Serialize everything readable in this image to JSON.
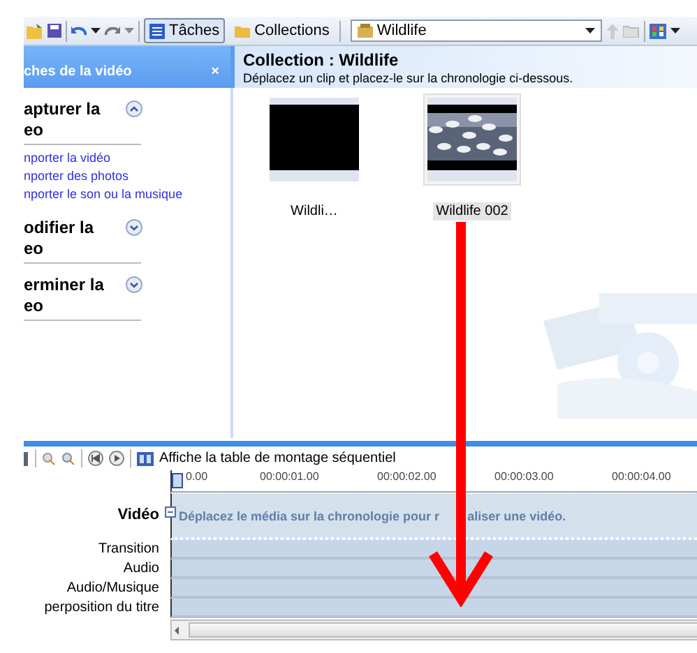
{
  "toolbar": {
    "tasks_button": {
      "label": "Tâches",
      "selected": true
    },
    "collections_button": {
      "label": "Collections",
      "selected": false
    },
    "collection_dropdown": {
      "value": "Wildlife"
    }
  },
  "tasks_pane": {
    "title": "ches de la vidéo",
    "close": "×",
    "sections": [
      {
        "title_lines": [
          "apturer la",
          "eo"
        ],
        "expanded": true,
        "links": [
          "nporter la vidéo",
          "nporter des photos",
          "nporter le son ou la musique"
        ]
      },
      {
        "title_lines": [
          "odifier la",
          "eo"
        ],
        "expanded": false
      },
      {
        "title_lines": [
          "erminer la",
          "eo"
        ],
        "expanded": false
      }
    ]
  },
  "collection": {
    "title": "Collection : Wildlife",
    "hint": "Déplacez un clip et placez-le sur la chronologie ci-dessous.",
    "clips": [
      {
        "label": "Wildli…",
        "kind": "blank",
        "selected": false
      },
      {
        "label": "Wildlife 002",
        "kind": "picture",
        "selected": true
      }
    ]
  },
  "timeline": {
    "toolbar_label": "Affiche la table de montage séquentiel",
    "ruler": [
      "0.00",
      "00:00:01.00",
      "00:00:02.00",
      "00:00:03.00",
      "00:00:04.00"
    ],
    "tracks": [
      {
        "label": "Vidéo",
        "kind": "video",
        "expanded": true,
        "hint_parts": [
          "Déplacez le média sur la chronologie pour r",
          "aliser une vidéo."
        ]
      },
      {
        "label": "Transition",
        "kind": "sub"
      },
      {
        "label": "Audio",
        "kind": "sub"
      },
      {
        "label": "Audio/Musique",
        "kind": "main"
      },
      {
        "label": "perposition du titre",
        "kind": "main"
      }
    ]
  },
  "annotations": [
    {
      "kind": "arrow"
    }
  ]
}
